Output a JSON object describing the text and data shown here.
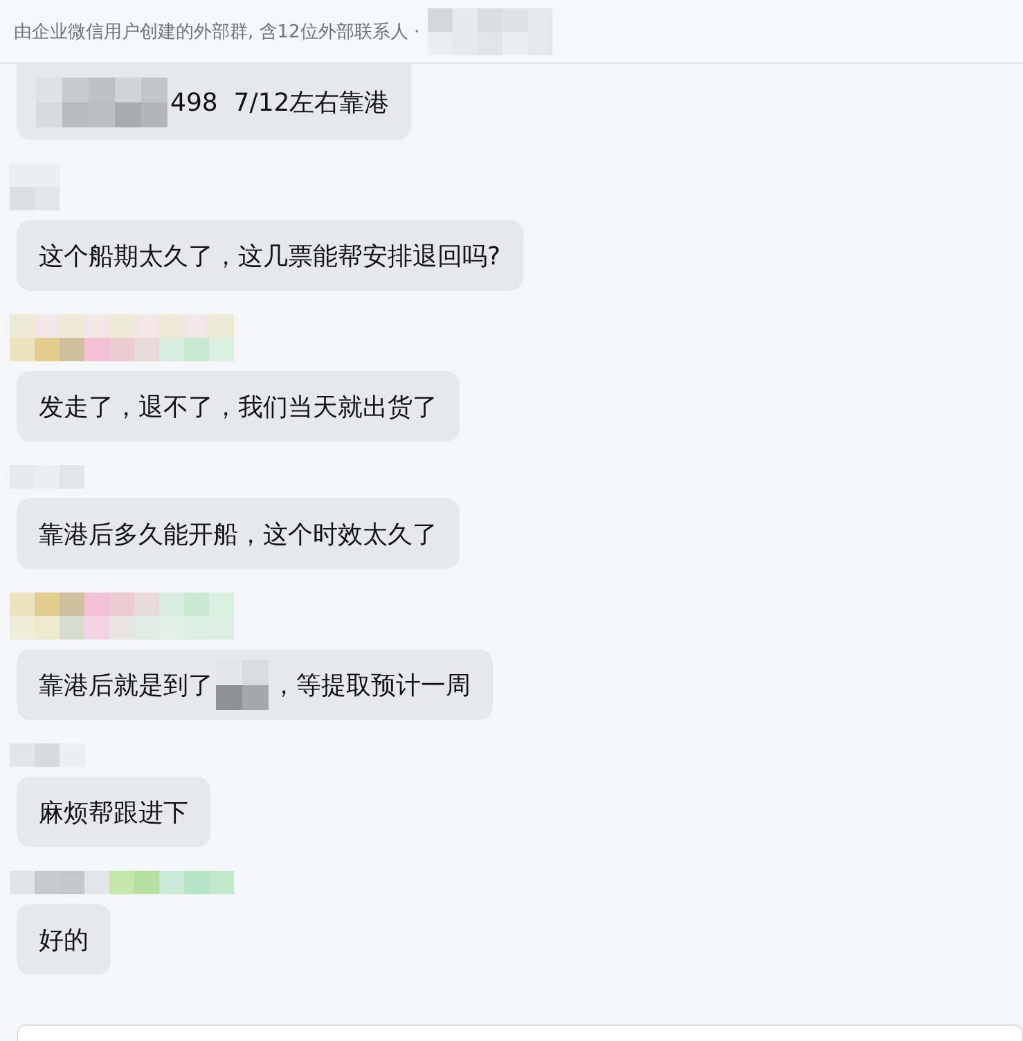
{
  "header": {
    "text": "由企业微信用户创建的外部群, 含12位外部联系人 ·",
    "trailing": {
      "kind": "redacted"
    }
  },
  "messages": [
    {
      "sender": {
        "kind": "none"
      },
      "cut_top": true,
      "parts": [
        {
          "kind": "redacted"
        },
        {
          "kind": "text",
          "text": "498  7/12左右靠港"
        }
      ]
    },
    {
      "sender": {
        "kind": "redacted"
      },
      "cut_top": false,
      "parts": [
        {
          "kind": "text",
          "text": "这个船期太久了，这几票能帮安排退回吗?"
        }
      ]
    },
    {
      "sender": {
        "kind": "redacted"
      },
      "cut_top": false,
      "parts": [
        {
          "kind": "text",
          "text": "发走了，退不了，我们当天就出货了"
        }
      ]
    },
    {
      "sender": {
        "kind": "redacted"
      },
      "cut_top": false,
      "parts": [
        {
          "kind": "text",
          "text": "靠港后多久能开船，这个时效太久了"
        }
      ]
    },
    {
      "sender": {
        "kind": "redacted"
      },
      "cut_top": false,
      "parts": [
        {
          "kind": "text",
          "text": "靠港后就是到了"
        },
        {
          "kind": "redacted"
        },
        {
          "kind": "text",
          "text": "，等提取预计一周"
        }
      ]
    },
    {
      "sender": {
        "kind": "redacted"
      },
      "cut_top": false,
      "parts": [
        {
          "kind": "text",
          "text": "麻烦帮跟进下"
        }
      ]
    },
    {
      "sender": {
        "kind": "redacted"
      },
      "cut_top": false,
      "parts": [
        {
          "kind": "text",
          "text": "好的"
        }
      ]
    }
  ],
  "composer": {
    "kind": "input"
  }
}
